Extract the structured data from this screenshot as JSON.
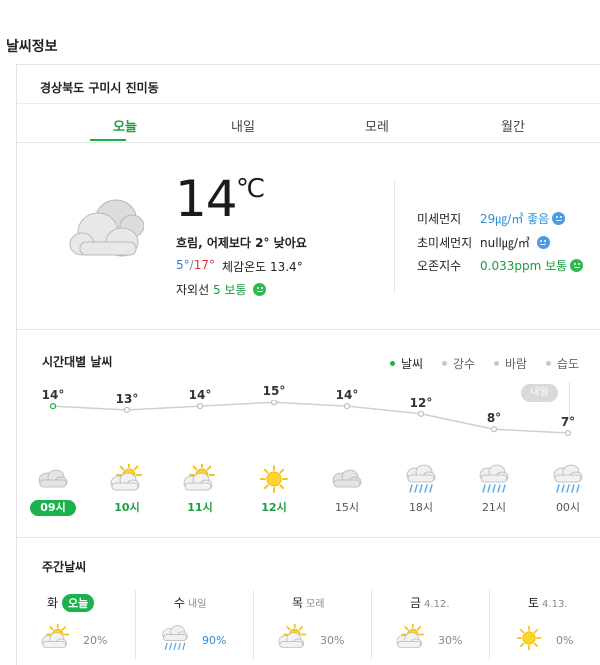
{
  "page_title": "날씨정보",
  "location": "경상북도 구미시 진미동",
  "tabs": [
    {
      "label": "오늘"
    },
    {
      "label": "내일"
    },
    {
      "label": "모레"
    },
    {
      "label": "월간"
    }
  ],
  "current": {
    "temp": "14",
    "unit": "℃",
    "summary": "흐림, 어제보다 2° 낮아요",
    "min": "5°",
    "max": "17°",
    "minmax_sep": "/",
    "feels_like": "체감온도 13.4°",
    "uv_label": "자외선",
    "uv_value": "5 보통"
  },
  "air": [
    {
      "label": "미세먼지",
      "value": "29㎍/㎥ 좋음",
      "status": "good"
    },
    {
      "label": "초미세먼지",
      "value": "null㎍/㎥",
      "status": "plain"
    },
    {
      "label": "오존지수",
      "value": "0.033ppm 보통",
      "status": "normal"
    }
  ],
  "hourly": {
    "title": "시간대별 날씨",
    "legend": [
      {
        "label": "날씨",
        "active": true
      },
      {
        "label": "강수",
        "active": false
      },
      {
        "label": "바람",
        "active": false
      },
      {
        "label": "습도",
        "active": false
      }
    ],
    "tomorrow_label": "내일",
    "hours": [
      {
        "time": "09시",
        "temp": 14,
        "temp_label": "14°",
        "icon": "cloud-icon",
        "now": true
      },
      {
        "time": "10시",
        "temp": 13,
        "temp_label": "13°",
        "icon": "partly-sunny-icon"
      },
      {
        "time": "11시",
        "temp": 14,
        "temp_label": "14°",
        "icon": "partly-sunny-icon"
      },
      {
        "time": "12시",
        "temp": 15,
        "temp_label": "15°",
        "icon": "sun-icon"
      },
      {
        "time": "15시",
        "temp": 14,
        "temp_label": "14°",
        "icon": "cloud-icon"
      },
      {
        "time": "18시",
        "temp": 12,
        "temp_label": "12°",
        "icon": "rain-icon"
      },
      {
        "time": "21시",
        "temp": 8,
        "temp_label": "8°",
        "icon": "rain-icon"
      },
      {
        "time": "00시",
        "temp": 7,
        "temp_label": "7°",
        "icon": "rain-icon"
      }
    ]
  },
  "weekly": {
    "title": "주간날씨",
    "days": [
      {
        "day": "화",
        "sub": "",
        "badge": "오늘",
        "icon": "partly-sunny-icon",
        "pop": "20%",
        "pop_blue": false
      },
      {
        "day": "수",
        "sub": "내일",
        "badge": "",
        "icon": "rain-icon",
        "pop": "90%",
        "pop_blue": true
      },
      {
        "day": "목",
        "sub": "모레",
        "badge": "",
        "icon": "partly-sunny-icon",
        "pop": "30%",
        "pop_blue": false
      },
      {
        "day": "금",
        "sub": "4.12.",
        "badge": "",
        "icon": "partly-sunny-icon",
        "pop": "30%",
        "pop_blue": false
      },
      {
        "day": "토",
        "sub": "4.13.",
        "badge": "",
        "icon": "sun-icon",
        "pop": "0%",
        "pop_blue": false
      }
    ]
  },
  "colors": {
    "accent": "#19b24b",
    "rain_blue": "#2b8fd9",
    "max_red": "#e5343a"
  }
}
